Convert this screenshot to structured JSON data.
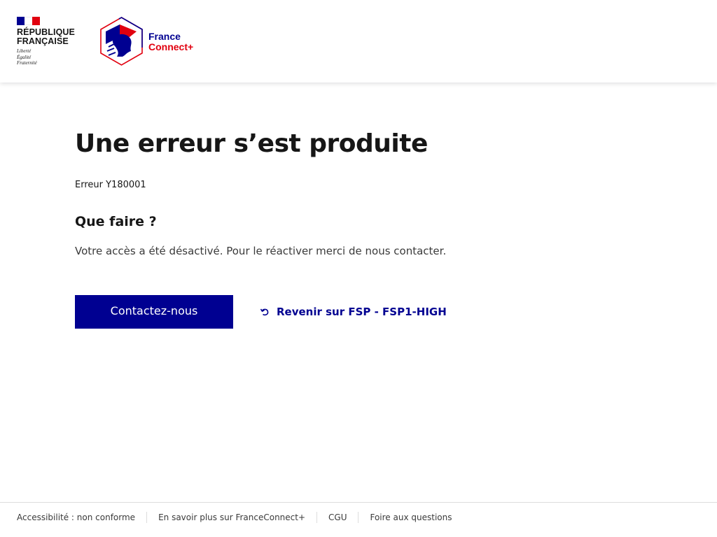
{
  "header": {
    "republique_line1": "RÉPUBLIQUE",
    "republique_line2": "FRANÇAISE",
    "motto_1": "Liberté",
    "motto_2": "Égalité",
    "motto_3": "Fraternité",
    "brand_line1": "France",
    "brand_line2": "Connect+"
  },
  "main": {
    "title": "Une erreur s’est produite",
    "error_code": "Erreur Y180001",
    "subtitle": "Que faire ?",
    "description": "Votre accès a été désactivé. Pour le réactiver merci de nous contacter.",
    "contact_button": "Contactez-nous",
    "back_link": "Revenir sur FSP - FSP1-HIGH"
  },
  "footer": {
    "links": [
      "Accessibilité : non conforme",
      "En savoir plus sur FranceConnect+",
      "CGU",
      "Foire aux questions"
    ]
  },
  "colors": {
    "primary": "#000091",
    "accent_red": "#e1000f",
    "text": "#161616"
  }
}
